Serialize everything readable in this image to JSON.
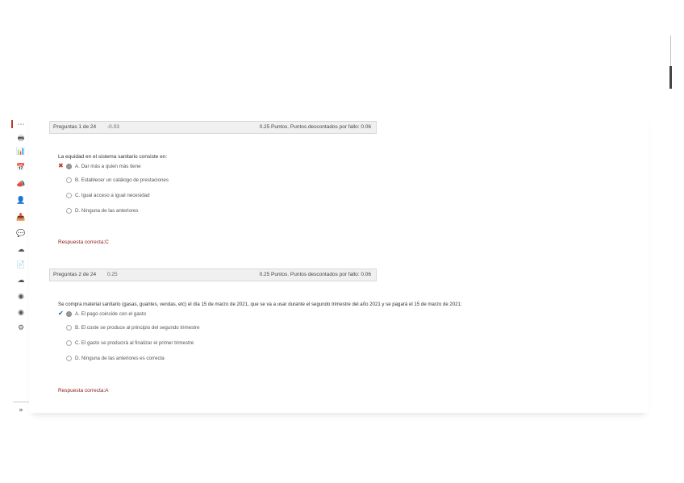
{
  "sidebar": {
    "icons": [
      "print-icon",
      "chart-icon",
      "calendar-icon",
      "megaphone-icon",
      "user-icon",
      "inbox-icon",
      "chat-icon",
      "cloud-check-icon",
      "document-icon",
      "cloud-icon",
      "globe-icon",
      "globe-alt-icon",
      "settings-icon",
      "chevrons-icon"
    ],
    "glyphs": [
      "🖶",
      "📊",
      "📅",
      "📣",
      "👤",
      "📥",
      "💬",
      "☁",
      "📄",
      "☁",
      "◉",
      "◉",
      "⚙",
      "»"
    ]
  },
  "questions": [
    {
      "header": {
        "num": "Preguntas 1 de 24",
        "score": "-0.03",
        "pts": "0.25 Puntos. Puntos descontados por fallo: 0.06"
      },
      "text": "La equidad en el sistema sanitario consiste en:",
      "options": [
        {
          "mark": "✖",
          "mark_type": "wrong",
          "selected": true,
          "label": "A. Dar más a quien más tiene"
        },
        {
          "mark": "",
          "mark_type": "",
          "selected": false,
          "label": "B. Establecer un catálogo de prestaciones"
        },
        {
          "mark": "",
          "mark_type": "",
          "selected": false,
          "label": "C. Igual acceso a igual necesidad"
        },
        {
          "mark": "",
          "mark_type": "",
          "selected": false,
          "label": "D. Ninguna de las anteriores"
        }
      ],
      "answer": "Respuesta correcta:C"
    },
    {
      "header": {
        "num": "Preguntas 2 de 24",
        "score": "0.25",
        "pts": "0.25 Puntos. Puntos descontados por fallo: 0.06"
      },
      "text": "Se compra material sanitario (gasas, guantes, vendas, etc) el día 15 de marzo de 2021, que se va a usar durante el segundo trimestre del año 2021 y se pagará el 15 de marzo de 2021:",
      "options": [
        {
          "mark": "✔",
          "mark_type": "right",
          "selected": true,
          "label": "A. El pago coincide con el gasto"
        },
        {
          "mark": "",
          "mark_type": "",
          "selected": false,
          "label": "B. El coste se produce al principio del segundo trimestre"
        },
        {
          "mark": "",
          "mark_type": "",
          "selected": false,
          "label": "C. El gasto se producirá al finalizar el primer trimestre"
        },
        {
          "mark": "",
          "mark_type": "",
          "selected": false,
          "label": "D. Ninguna de las anteriores es correcta"
        }
      ],
      "answer": "Respuesta correcta:A"
    }
  ]
}
